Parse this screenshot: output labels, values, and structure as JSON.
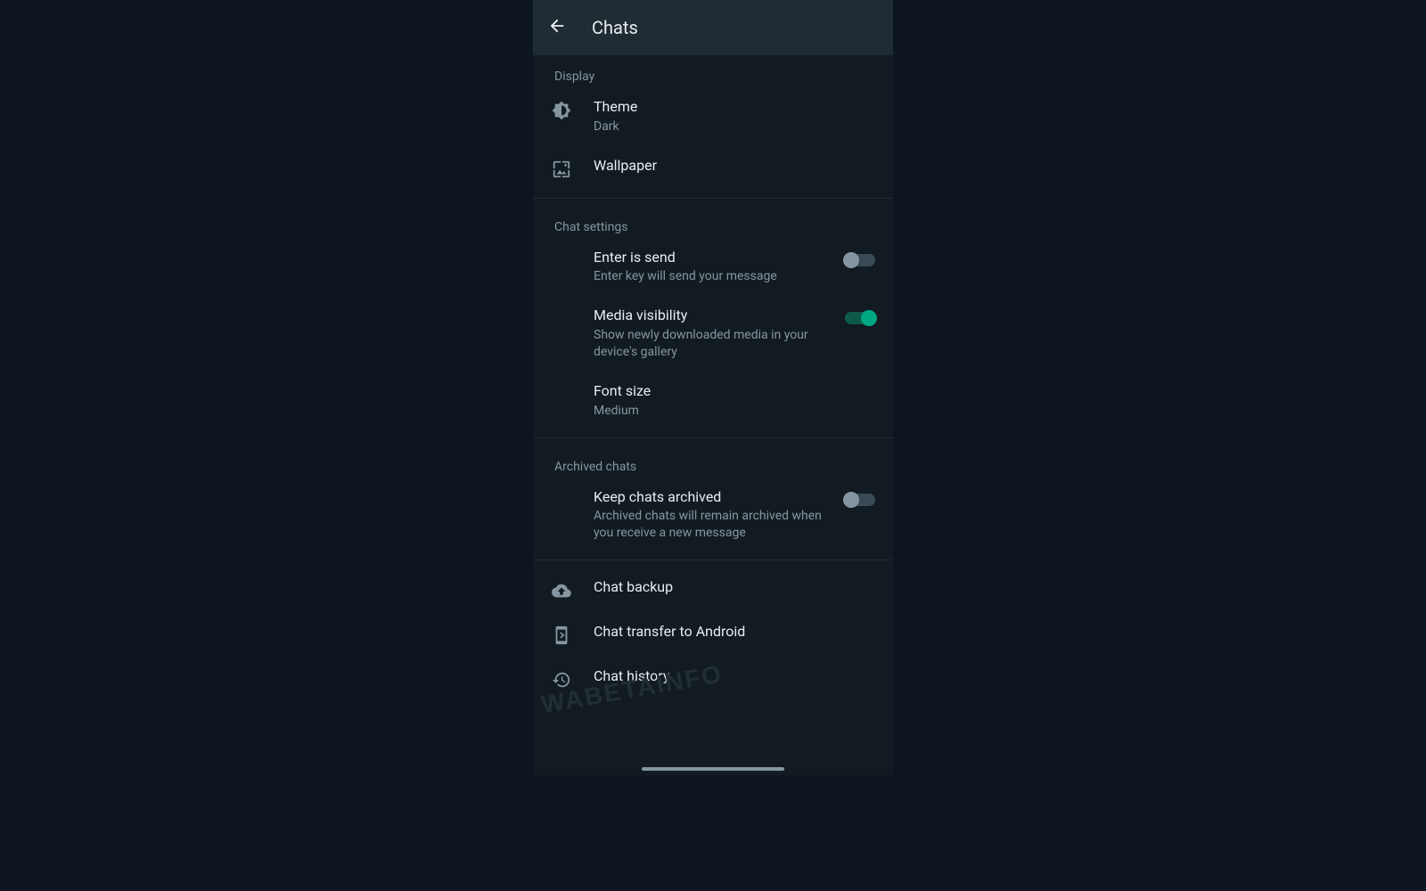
{
  "header": {
    "title": "Chats"
  },
  "sections": {
    "display": {
      "label": "Display",
      "theme": {
        "title": "Theme",
        "value": "Dark"
      },
      "wallpaper": {
        "title": "Wallpaper"
      }
    },
    "chat_settings": {
      "label": "Chat settings",
      "enter_send": {
        "title": "Enter is send",
        "sub": "Enter key will send your message",
        "on": false
      },
      "media_visibility": {
        "title": "Media visibility",
        "sub": "Show newly downloaded media in your device's gallery",
        "on": true
      },
      "font_size": {
        "title": "Font size",
        "value": "Medium"
      }
    },
    "archived": {
      "label": "Archived chats",
      "keep_archived": {
        "title": "Keep chats archived",
        "sub": "Archived chats will remain archived when you receive a new message",
        "on": false
      }
    },
    "other": {
      "backup": {
        "title": "Chat backup"
      },
      "transfer": {
        "title": "Chat transfer to Android"
      },
      "history": {
        "title": "Chat history"
      }
    }
  },
  "watermark": "WABETAINFO"
}
